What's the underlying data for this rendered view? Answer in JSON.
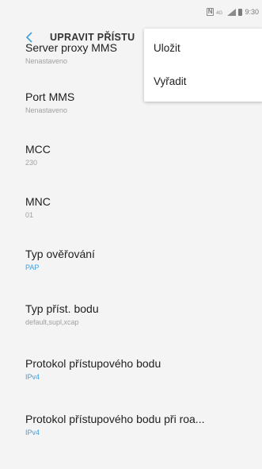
{
  "status_bar": {
    "time": "9:30",
    "nfc_label": "N",
    "icons": [
      "nfc-icon",
      "volte-icon",
      "signal-icon",
      "battery-icon"
    ]
  },
  "app_bar": {
    "back_icon": "back-chevron-icon",
    "title": "UPRAVIT PŘÍSTU"
  },
  "menu": {
    "items": [
      {
        "label": "Uložit"
      },
      {
        "label": "Vyřadit"
      }
    ]
  },
  "settings": {
    "items": [
      {
        "label": "Server proxy MMS",
        "value": "Nenastaveno",
        "accent": false
      },
      {
        "label": "Port MMS",
        "value": "Nenastaveno",
        "accent": false
      },
      {
        "label": "MCC",
        "value": "230",
        "accent": false
      },
      {
        "label": "MNC",
        "value": "01",
        "accent": false
      },
      {
        "label": "Typ ověřování",
        "value": "PAP",
        "accent": true
      },
      {
        "label": "Typ příst. bodu",
        "value": "default,supl,xcap",
        "accent": false
      },
      {
        "label": "Protokol přístupového bodu",
        "value": "IPv4",
        "accent": true
      },
      {
        "label": "Protokol přístupového bodu při roa...",
        "value": "IPv4",
        "accent": true
      }
    ]
  },
  "colors": {
    "background": "#f4f4f4",
    "accent": "#3f9ee0",
    "text_primary": "#1e1e1e",
    "text_secondary": "#a0a0a0"
  }
}
